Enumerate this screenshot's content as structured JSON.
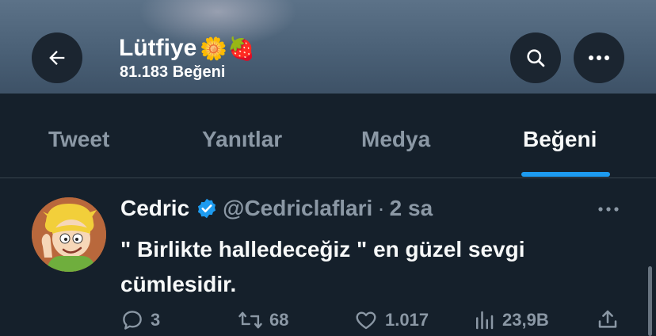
{
  "profile": {
    "name": "Lütfiye",
    "name_emoji": "🌼🍓",
    "likes_count": "81.183 Beğeni"
  },
  "icons": {
    "back": "arrow-left-icon",
    "search": "search-icon",
    "more": "more-horizontal-icon"
  },
  "tabs": [
    {
      "label": "Tweet",
      "active": false
    },
    {
      "label": "Yanıtlar",
      "active": false
    },
    {
      "label": "Medya",
      "active": false
    },
    {
      "label": "Beğeni",
      "active": true
    }
  ],
  "tweet": {
    "author": "Cedric",
    "handle": "@Cedriclaflari",
    "separator": "·",
    "time": "2 sa",
    "text": "\" Birlikte halledeceğiz \" en güzel sevgi cümlesidir.",
    "replies": "3",
    "retweets": "68",
    "likes": "1.017",
    "views": "23,9B"
  },
  "colors": {
    "background": "#15202b",
    "accent": "#1d9bf0",
    "muted": "#8b98a5",
    "text": "#f7f9f9"
  }
}
